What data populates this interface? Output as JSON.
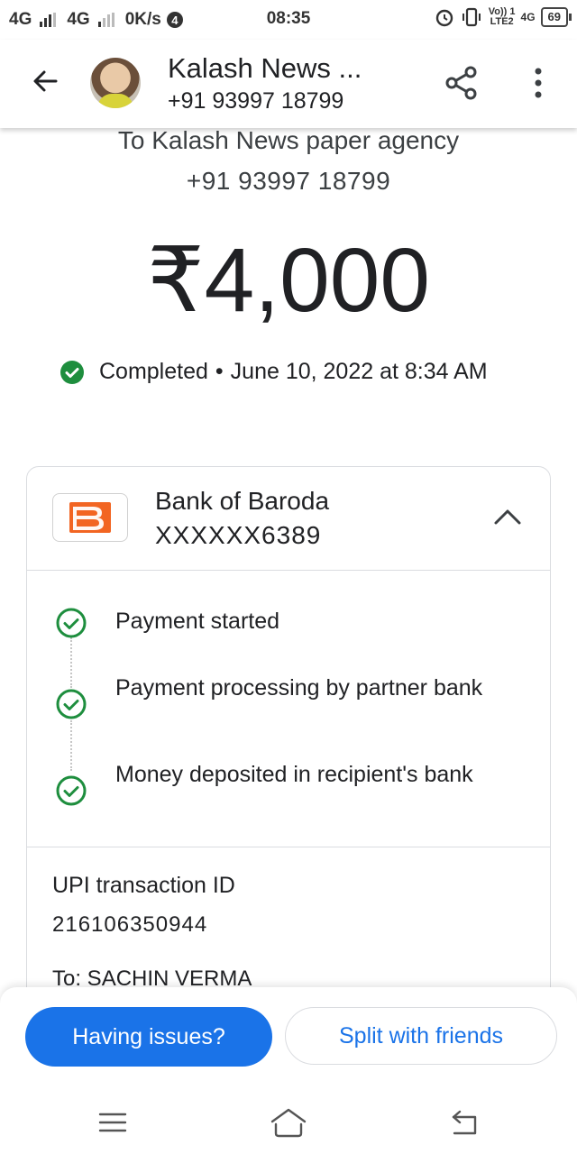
{
  "status_bar": {
    "network1": "4G",
    "network2": "4G",
    "speed": "0K/s",
    "notif_count": "4",
    "time": "08:35",
    "volte_top": "Vo)) 1",
    "volte_bottom": "LTE2",
    "net3": "4G",
    "battery": "69"
  },
  "header": {
    "title": "Kalash News ...",
    "subtitle": "+91 93997 18799"
  },
  "recipient": {
    "to_line": "To Kalash News paper agency",
    "phone": "+91 93997 18799"
  },
  "amount": "₹4,000",
  "status": {
    "state": "Completed",
    "separator": "•",
    "datetime": "June 10, 2022 at 8:34 AM"
  },
  "bank": {
    "name": "Bank of Baroda",
    "account": "XXXXXX6389"
  },
  "steps": [
    {
      "label": "Payment started"
    },
    {
      "label": "Payment processing by partner bank"
    },
    {
      "label": "Money deposited in recipient's bank"
    }
  ],
  "details": {
    "upi_label": "UPI transaction ID",
    "upi_id": "216106350944",
    "to_name": "To: SACHIN VERMA"
  },
  "actions": {
    "issues": "Having issues?",
    "split": "Split with friends"
  },
  "colors": {
    "accent": "#1a73e8",
    "success": "#1e8e3e",
    "bank_brand": "#f26522"
  }
}
